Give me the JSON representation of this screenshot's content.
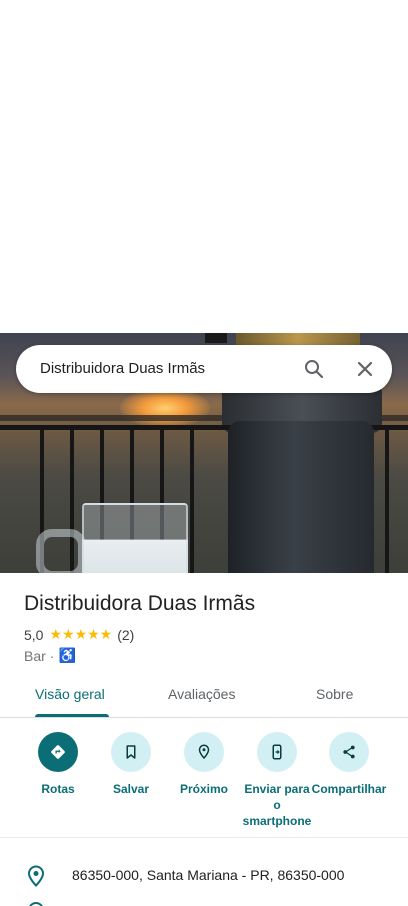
{
  "search": {
    "query": "Distribuidora Duas Irmãs",
    "search_icon": "search-icon",
    "clear_icon": "close-icon"
  },
  "place": {
    "name": "Distribuidora Duas Irmãs",
    "rating": "5,0",
    "stars": "★★★★★",
    "star_count": 5,
    "reviews": "(2)",
    "category": "Bar",
    "separator": "·",
    "accessibility_icon": "wheelchair-icon"
  },
  "tabs": [
    {
      "label": "Visão geral",
      "active": true
    },
    {
      "label": "Avaliações",
      "active": false
    },
    {
      "label": "Sobre",
      "active": false
    }
  ],
  "actions": [
    {
      "label": "Rotas",
      "icon": "directions-icon"
    },
    {
      "label": "Salvar",
      "icon": "bookmark-icon"
    },
    {
      "label": "Próximo",
      "icon": "nearby-icon"
    },
    {
      "label": "Enviar para o smartphone",
      "icon": "send-to-phone-icon"
    },
    {
      "label": "Compartilhar",
      "icon": "share-icon"
    }
  ],
  "address": {
    "text": "86350-000, Santa Mariana - PR, 86350-000",
    "icon": "location-pin-icon"
  },
  "colors": {
    "accent": "#0b6e77",
    "action_bg": "#d2f0f4",
    "star": "#fbbc04"
  }
}
